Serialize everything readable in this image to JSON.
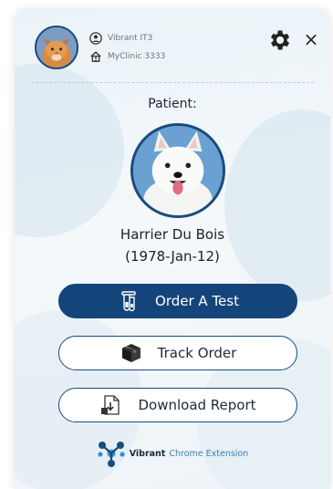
{
  "account": {
    "user_name": "Vibrant IT3",
    "clinic_name": "MyClinic 3333",
    "user_icon": "user-circle-icon",
    "clinic_icon": "home-icon"
  },
  "header": {
    "settings_icon": "gear-icon",
    "close_label": "×"
  },
  "patient": {
    "label": "Patient:",
    "name": "Harrier Du Bois",
    "dob": "(1978-Jan-12)"
  },
  "actions": {
    "order_label": "Order A Test",
    "track_label": "Track Order",
    "download_label": "Download Report"
  },
  "footer": {
    "brand": "Vibrant",
    "product": "Chrome Extension"
  },
  "colors": {
    "primary": "#14457a",
    "accent": "#3d7fb0",
    "panel_bg": "#eef4f7"
  }
}
